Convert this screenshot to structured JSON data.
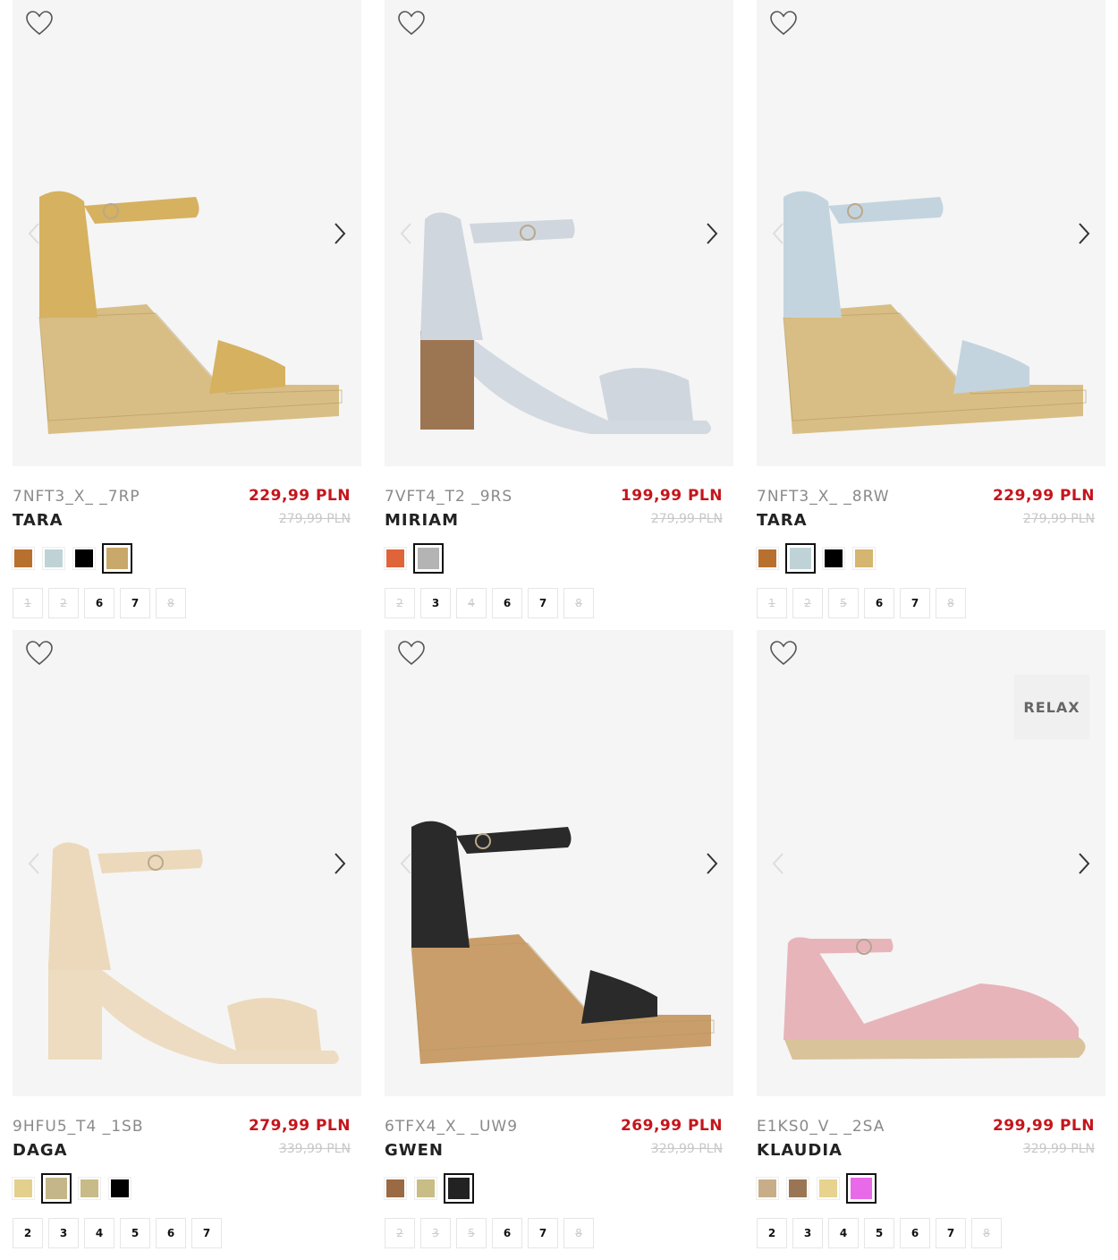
{
  "products": [
    {
      "sku": "7NFT3_X_ _7RP",
      "name": "TARA",
      "price": "229,99 PLN",
      "old_price": "279,99 PLN",
      "colors": [
        "#b8702f",
        "#bfd3d6",
        "#000000",
        "#c9a86b"
      ],
      "selected_color": 3,
      "sizes": [
        {
          "label": "1",
          "available": false
        },
        {
          "label": "2",
          "available": false
        },
        {
          "label": "6",
          "available": true
        },
        {
          "label": "7",
          "available": true
        },
        {
          "label": "8",
          "available": false
        }
      ],
      "badge": "",
      "shoe": {
        "style": "wedge",
        "upper": "#d6b15f",
        "sole": "#d8be85"
      }
    },
    {
      "sku": "7VFT4_T2 _9RS",
      "name": "MIRIAM",
      "price": "199,99 PLN",
      "old_price": "279,99 PLN",
      "colors": [
        "#e0643a",
        "#b4b4b4"
      ],
      "selected_color": 1,
      "sizes": [
        {
          "label": "2",
          "available": false
        },
        {
          "label": "3",
          "available": true
        },
        {
          "label": "4",
          "available": false
        },
        {
          "label": "6",
          "available": true
        },
        {
          "label": "7",
          "available": true
        },
        {
          "label": "8",
          "available": false
        }
      ],
      "badge": "",
      "shoe": {
        "style": "block",
        "upper": "#cfd6de",
        "sole": "#9c7552"
      }
    },
    {
      "sku": "7NFT3_X_ _8RW",
      "name": "TARA",
      "price": "229,99 PLN",
      "old_price": "279,99 PLN",
      "colors": [
        "#b8702f",
        "#bfd3d6",
        "#000000",
        "#d4b670"
      ],
      "selected_color": 1,
      "sizes": [
        {
          "label": "1",
          "available": false
        },
        {
          "label": "2",
          "available": false
        },
        {
          "label": "5",
          "available": false
        },
        {
          "label": "6",
          "available": true
        },
        {
          "label": "7",
          "available": true
        },
        {
          "label": "8",
          "available": false
        }
      ],
      "badge": "",
      "shoe": {
        "style": "wedge",
        "upper": "#c3d4de",
        "sole": "#d8be85"
      }
    },
    {
      "sku": "9HFU5_T4 _1SB",
      "name": "DAGA",
      "price": "279,99 PLN",
      "old_price": "339,99 PLN",
      "colors": [
        "#e3d08d",
        "#c4b688",
        "#c8bb87",
        "#000000"
      ],
      "selected_color": 1,
      "sizes": [
        {
          "label": "2",
          "available": true
        },
        {
          "label": "3",
          "available": true
        },
        {
          "label": "4",
          "available": true
        },
        {
          "label": "5",
          "available": true
        },
        {
          "label": "6",
          "available": true
        },
        {
          "label": "7",
          "available": true
        }
      ],
      "badge": "",
      "shoe": {
        "style": "block",
        "upper": "#ecd9bb",
        "sole": "#eedcc0"
      }
    },
    {
      "sku": "6TFX4_X_ _UW9",
      "name": "GWEN",
      "price": "269,99 PLN",
      "old_price": "329,99 PLN",
      "colors": [
        "#9a6a44",
        "#c9bd86",
        "#222222"
      ],
      "selected_color": 2,
      "sizes": [
        {
          "label": "2",
          "available": false
        },
        {
          "label": "3",
          "available": false
        },
        {
          "label": "5",
          "available": false
        },
        {
          "label": "6",
          "available": true
        },
        {
          "label": "7",
          "available": true
        },
        {
          "label": "8",
          "available": false
        }
      ],
      "badge": "",
      "shoe": {
        "style": "wedge",
        "upper": "#2a2a2a",
        "sole": "#c99e6a"
      }
    },
    {
      "sku": "E1KS0_V_ _2SA",
      "name": "KLAUDIA",
      "price": "299,99 PLN",
      "old_price": "329,99 PLN",
      "colors": [
        "#c8ae88",
        "#9a7555",
        "#e7d38f",
        "#e86ae8"
      ],
      "selected_color": 3,
      "sizes": [
        {
          "label": "2",
          "available": true
        },
        {
          "label": "3",
          "available": true
        },
        {
          "label": "4",
          "available": true
        },
        {
          "label": "5",
          "available": true
        },
        {
          "label": "6",
          "available": true
        },
        {
          "label": "7",
          "available": true
        },
        {
          "label": "8",
          "available": false
        }
      ],
      "badge": "RELAX",
      "shoe": {
        "style": "flat",
        "upper": "#e7b4ba",
        "sole": "#d9c39a"
      }
    }
  ],
  "icons": {
    "wishlist": "heart-outline-icon",
    "previous": "chevron-left-icon",
    "next": "chevron-right-icon"
  }
}
